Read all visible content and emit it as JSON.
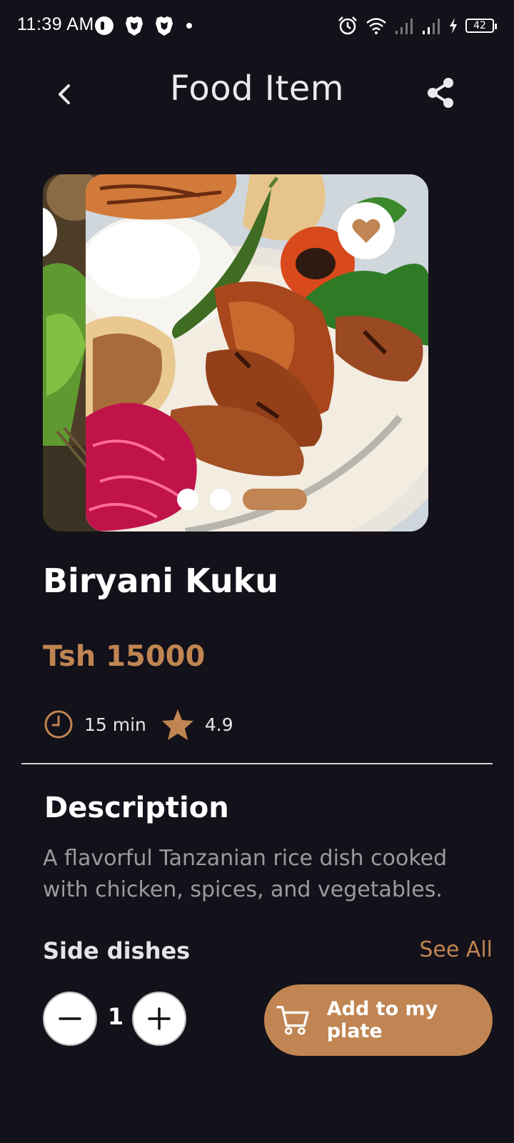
{
  "status_bar": {
    "time": "11:39 AM",
    "battery": "42"
  },
  "app_bar": {
    "title": "Food Item"
  },
  "food": {
    "name": "Biryani Kuku",
    "price": "Tsh 15000",
    "time": "15 min",
    "rating": "4.9"
  },
  "carousel": {
    "page_count": 3,
    "active_index": 2
  },
  "description": {
    "heading": "Description",
    "text": "A flavorful Tanzanian rice dish cooked with chicken, spices, and vegetables."
  },
  "side_dishes": {
    "label": "Side dishes",
    "see_all": "See All"
  },
  "quantity": {
    "value": "1"
  },
  "add_button": {
    "label": "Add to my plate"
  },
  "colors": {
    "background": "#13111a",
    "accent": "#c08552",
    "text_primary": "#ffffff",
    "text_secondary": "#9a9aa0"
  },
  "icons": {
    "back": "back-arrow-icon",
    "share": "share-icon",
    "favorite": "heart-icon",
    "clock": "clock-icon",
    "star": "star-icon",
    "minus": "minus-icon",
    "plus": "plus-icon",
    "cart": "cart-icon"
  }
}
